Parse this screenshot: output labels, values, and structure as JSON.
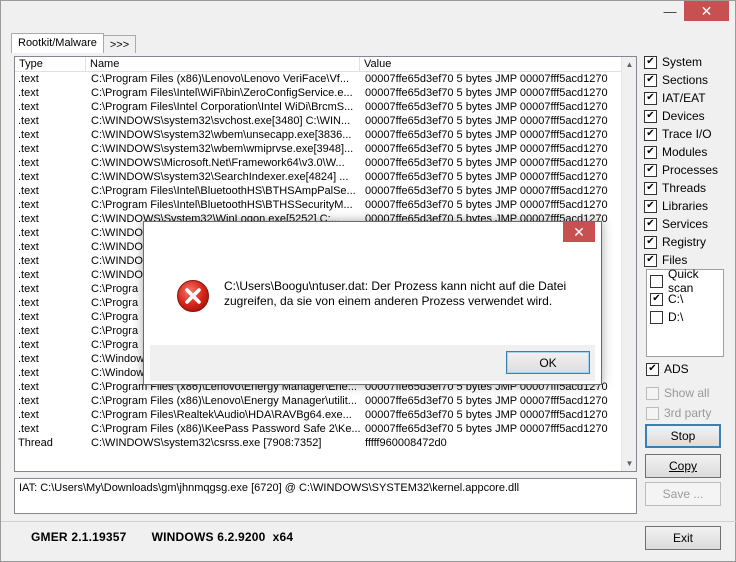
{
  "titlebar": {
    "minimize": "—",
    "close": "✕"
  },
  "tabs": [
    {
      "label": "Rootkit/Malware"
    },
    {
      "label": ">>>"
    }
  ],
  "table": {
    "columns": [
      "Type",
      "Name",
      "Value"
    ],
    "rows": [
      [
        ".text",
        "C:\\Program Files (x86)\\Lenovo\\Lenovo VeriFace\\Vf...",
        "00007ffe65d3ef70 5 bytes JMP 00007fff5acd1270"
      ],
      [
        ".text",
        "C:\\Program Files\\Intel\\WiFi\\bin\\ZeroConfigService.e...",
        "00007ffe65d3ef70 5 bytes JMP 00007fff5acd1270"
      ],
      [
        ".text",
        "C:\\Program Files\\Intel Corporation\\Intel WiDi\\BrcmS...",
        "00007ffe65d3ef70 5 bytes JMP 00007fff5acd1270"
      ],
      [
        ".text",
        "C:\\WINDOWS\\system32\\svchost.exe[3480] C:\\WIN...",
        "00007ffe65d3ef70 5 bytes JMP 00007fff5acd1270"
      ],
      [
        ".text",
        "C:\\WINDOWS\\system32\\wbem\\unsecapp.exe[3836...",
        "00007ffe65d3ef70 5 bytes JMP 00007fff5acd1270"
      ],
      [
        ".text",
        "C:\\WINDOWS\\system32\\wbem\\wmiprvse.exe[3948]...",
        "00007ffe65d3ef70 5 bytes JMP 00007fff5acd1270"
      ],
      [
        ".text",
        "C:\\WINDOWS\\Microsoft.Net\\Framework64\\v3.0\\W...",
        "00007ffe65d3ef70 5 bytes JMP 00007fff5acd1270"
      ],
      [
        ".text",
        "C:\\WINDOWS\\system32\\SearchIndexer.exe[4824] ...",
        "00007ffe65d3ef70 5 bytes JMP 00007fff5acd1270"
      ],
      [
        ".text",
        "C:\\Program Files\\Intel\\BluetoothHS\\BTHSAmpPalSe...",
        "00007ffe65d3ef70 5 bytes JMP 00007fff5acd1270"
      ],
      [
        ".text",
        "C:\\Program Files\\Intel\\BluetoothHS\\BTHSSecurityM...",
        "00007ffe65d3ef70 5 bytes JMP 00007fff5acd1270"
      ],
      [
        ".text",
        "C:\\WINDOWS\\System32\\WinLogon.exe[5252] C:...",
        "00007ffe65d3ef70 5 bytes JMP 00007fff5acd1270"
      ],
      [
        ".text",
        "C:\\WINDO",
        ""
      ],
      [
        ".text",
        "C:\\WINDO",
        ""
      ],
      [
        ".text",
        "C:\\WINDO",
        ""
      ],
      [
        ".text",
        "C:\\WINDO",
        ""
      ],
      [
        ".text",
        "C:\\Progra",
        ""
      ],
      [
        ".text",
        "C:\\Progra",
        ""
      ],
      [
        ".text",
        "C:\\Progra",
        ""
      ],
      [
        ".text",
        "C:\\Progra",
        ""
      ],
      [
        ".text",
        "C:\\Progra",
        ""
      ],
      [
        ".text",
        "C:\\Window",
        ""
      ],
      [
        ".text",
        "C:\\Window",
        ""
      ],
      [
        ".text",
        "C:\\Program Files (x86)\\Lenovo\\Energy Manager\\Ene...",
        "00007ffe65d3ef70 5 bytes JMP 00007fff5acd1270"
      ],
      [
        ".text",
        "C:\\Program Files (x86)\\Lenovo\\Energy Manager\\utilit...",
        "00007ffe65d3ef70 5 bytes JMP 00007fff5acd1270"
      ],
      [
        ".text",
        "C:\\Program Files\\Realtek\\Audio\\HDA\\RAVBg64.exe...",
        "00007ffe65d3ef70 5 bytes JMP 00007fff5acd1270"
      ],
      [
        ".text",
        "C:\\Program Files (x86)\\KeePass Password Safe 2\\Ke...",
        "00007ffe65d3ef70 5 bytes JMP 00007fff5acd1270"
      ],
      [
        "Thread",
        "C:\\WINDOWS\\system32\\csrss.exe [7908:7352]",
        "fffff960008472d0"
      ]
    ]
  },
  "status_line": "IAT: C:\\Users\\My\\Downloads\\gm\\jhnmqgsg.exe [6720] @ C:\\WINDOWS\\SYSTEM32\\kernel.appcore.dll",
  "footer": {
    "version": "GMER 2.1.19357",
    "os": "WINDOWS 6.2.9200  x64"
  },
  "options": [
    {
      "label": "System",
      "checked": true
    },
    {
      "label": "Sections",
      "checked": true
    },
    {
      "label": "IAT/EAT",
      "checked": true
    },
    {
      "label": "Devices",
      "checked": true
    },
    {
      "label": "Trace I/O",
      "checked": true
    },
    {
      "label": "Modules",
      "checked": true
    },
    {
      "label": "Processes",
      "checked": true
    },
    {
      "label": "Threads",
      "checked": true
    },
    {
      "label": "Libraries",
      "checked": true
    },
    {
      "label": "Services",
      "checked": true
    },
    {
      "label": "Registry",
      "checked": true
    },
    {
      "label": "Files",
      "checked": true
    }
  ],
  "files": [
    {
      "label": "Quick scan",
      "checked": false
    },
    {
      "label": "C:\\",
      "checked": true
    },
    {
      "label": "D:\\",
      "checked": false
    }
  ],
  "ads": {
    "label": "ADS",
    "checked": true
  },
  "show_all": {
    "label": "Show all",
    "checked": false
  },
  "third_party": {
    "label": "3rd party",
    "checked": false
  },
  "buttons": {
    "stop": "Stop",
    "copy": "Copy",
    "save": "Save ...",
    "exit": "Exit"
  },
  "dialog": {
    "close": "✕",
    "message_line1": "C:\\Users\\Boogu\\ntuser.dat: Der Prozess kann nicht auf die Datei",
    "message_line2": "zugreifen, da sie von einem anderen Prozess verwendet wird.",
    "ok": "OK"
  },
  "check_mark": "✔"
}
